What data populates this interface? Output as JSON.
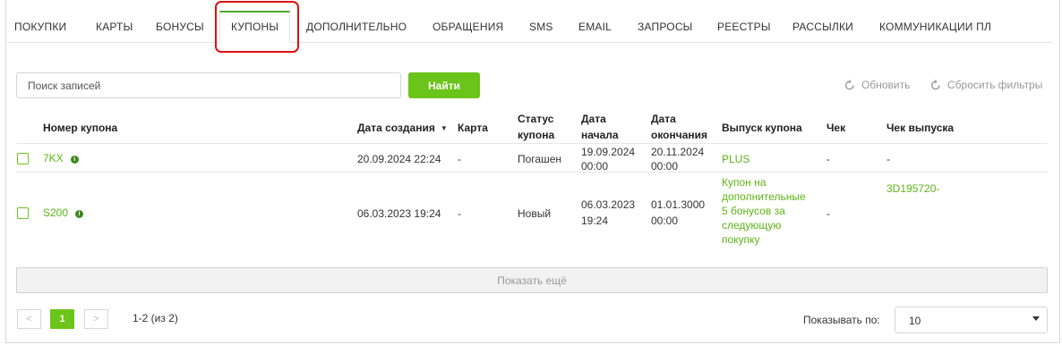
{
  "tabs": [
    {
      "label": "ПОКУПКИ"
    },
    {
      "label": "КАРТЫ"
    },
    {
      "label": "БОНУСЫ"
    },
    {
      "label": "КУПОНЫ",
      "active": true
    },
    {
      "label": "ДОПОЛНИТЕЛЬНО"
    },
    {
      "label": "ОБРАЩЕНИЯ"
    },
    {
      "label": "SMS"
    },
    {
      "label": "EMAIL"
    },
    {
      "label": "ЗАПРОСЫ"
    },
    {
      "label": "РЕЕСТРЫ"
    },
    {
      "label": "РАССЫЛКИ"
    },
    {
      "label": "КОММУНИКАЦИИ ПЛ"
    }
  ],
  "toolbar": {
    "search_placeholder": "Поиск записей",
    "find_label": "Найти",
    "refresh_label": "Обновить",
    "reset_label": "Сбросить фильтры"
  },
  "table": {
    "headers": {
      "number": "Номер купона",
      "created": "Дата создания",
      "card": "Карта",
      "status": [
        "Статус",
        "купона"
      ],
      "start": [
        "Дата",
        "начала"
      ],
      "end": [
        "Дата",
        "окончания"
      ],
      "issue": "Выпуск купона",
      "check": "Чек",
      "issue_check": "Чек выпуска"
    },
    "rows": [
      {
        "number": "7KX",
        "created": "20.09.2024 22:24",
        "card": "-",
        "status": "Погашен",
        "start": [
          "19.09.2024",
          "00:00"
        ],
        "end": [
          "20.11.2024",
          "00:00"
        ],
        "issue": [
          "PLUS"
        ],
        "check": "-",
        "issue_check": "-"
      },
      {
        "number": "S200",
        "created": "06.03.2023 19:24",
        "card": "-",
        "status": "Новый",
        "start": [
          "06.03.2023",
          "19:24"
        ],
        "end": [
          "01.01.3000",
          "00:00"
        ],
        "issue": [
          "Купон на",
          "дополнительные",
          "5 бонусов за",
          "следующую",
          "покупку"
        ],
        "check": "-",
        "issue_check": "3D195720-"
      }
    ]
  },
  "show_more_label": "Показать ещё",
  "pagination": {
    "prev": "<",
    "current": "1",
    "next": ">",
    "info": "1-2 (из 2)",
    "per_page_label": "Показывать по:",
    "per_page_value": "10"
  },
  "colors": {
    "accent": "#6bc419",
    "link": "#5cb516",
    "highlight": "#e01010"
  }
}
